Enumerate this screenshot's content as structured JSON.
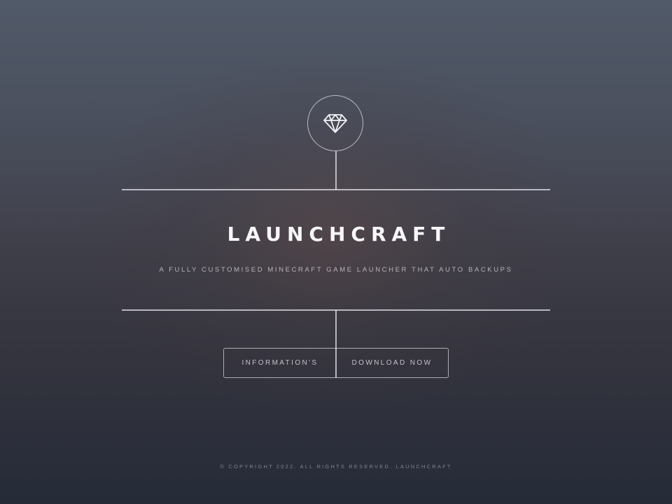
{
  "logo": {
    "icon": "diamond-icon"
  },
  "hero": {
    "title": "LAUNCHCRAFT",
    "tagline": "A FULLY CUSTOMISED MINECRAFT GAME LAUNCHER THAT AUTO BACKUPS"
  },
  "buttons": {
    "info_label": "INFORMATION'S",
    "download_label": "DOWNLOAD NOW"
  },
  "footer": {
    "copyright": "© COPYRIGHT 2022. ALL RIGHTS RESERVED. LAUNCHCRAFT"
  }
}
